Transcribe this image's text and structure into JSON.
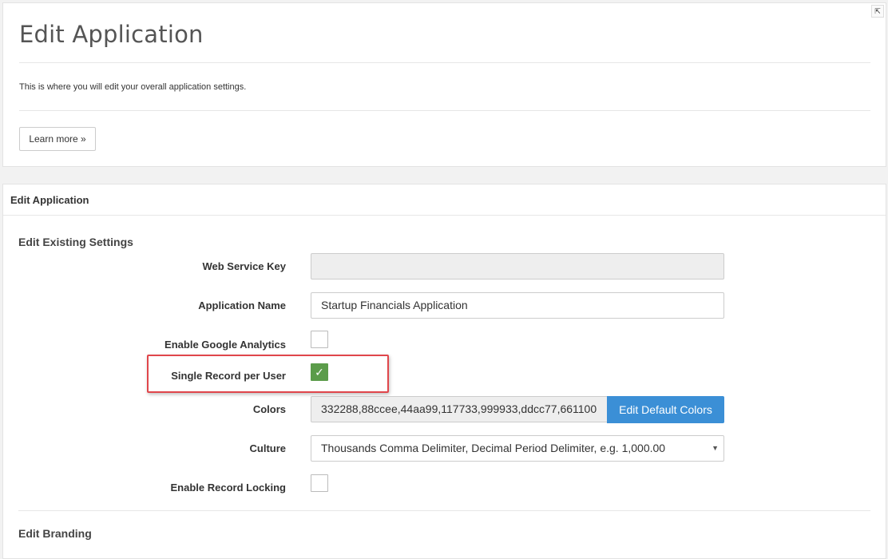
{
  "header": {
    "title": "Edit Application",
    "description": "This is where you will edit your overall application settings.",
    "learn_more_label": "Learn more »",
    "expand_icon_glyph": "⇱"
  },
  "panel": {
    "title": "Edit Application",
    "section_existing": "Edit Existing Settings",
    "section_branding": "Edit Branding"
  },
  "form": {
    "web_service_key": {
      "label": "Web Service Key",
      "value": ""
    },
    "application_name": {
      "label": "Application Name",
      "value": "Startup Financials Application"
    },
    "google_analytics": {
      "label": "Enable Google Analytics",
      "checked": false
    },
    "single_record": {
      "label": "Single Record per User",
      "checked": true,
      "check_glyph": "✓"
    },
    "colors": {
      "label": "Colors",
      "value": "332288,88ccee,44aa99,117733,999933,ddcc77,661100",
      "button_label": "Edit Default Colors"
    },
    "culture": {
      "label": "Culture",
      "value": "Thousands Comma Delimiter, Decimal Period Delimiter, e.g. 1,000.00",
      "arrow_glyph": "▼"
    },
    "record_locking": {
      "label": "Enable Record Locking",
      "checked": false
    }
  },
  "colors": {
    "primary_button": "#3b8fd6",
    "check_green": "#5b9c4a",
    "highlight_red": "#e0464b"
  }
}
